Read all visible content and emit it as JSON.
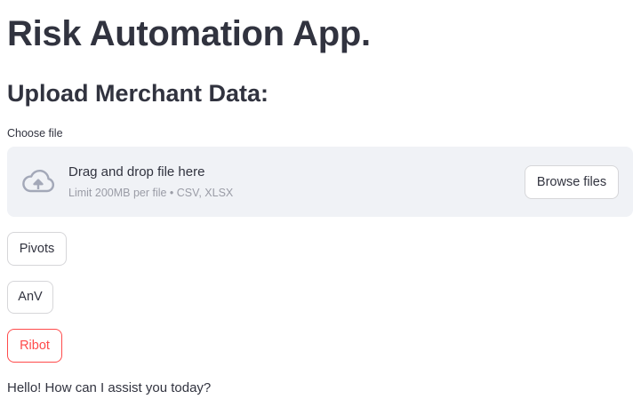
{
  "app": {
    "title": "Risk Automation App."
  },
  "upload_section": {
    "heading": "Upload Merchant Data:",
    "uploader_label": "Choose file",
    "dropzone": {
      "icon": "cloud-upload-icon",
      "instruction": "Drag and drop file here",
      "limit_text": "Limit 200MB per file • CSV, XLSX",
      "browse_label": "Browse files"
    }
  },
  "actions": {
    "pivots_label": "Pivots",
    "anv_label": "AnV",
    "ribot_label": "Ribot"
  },
  "chat": {
    "message": "Hello! How can I assist you today?"
  },
  "colors": {
    "text": "#31333f",
    "dropzone_bg": "#f0f2f6",
    "muted_text": "#9a9ca6",
    "active_accent": "#ff4b4b",
    "icon": "#a3a8b8"
  }
}
